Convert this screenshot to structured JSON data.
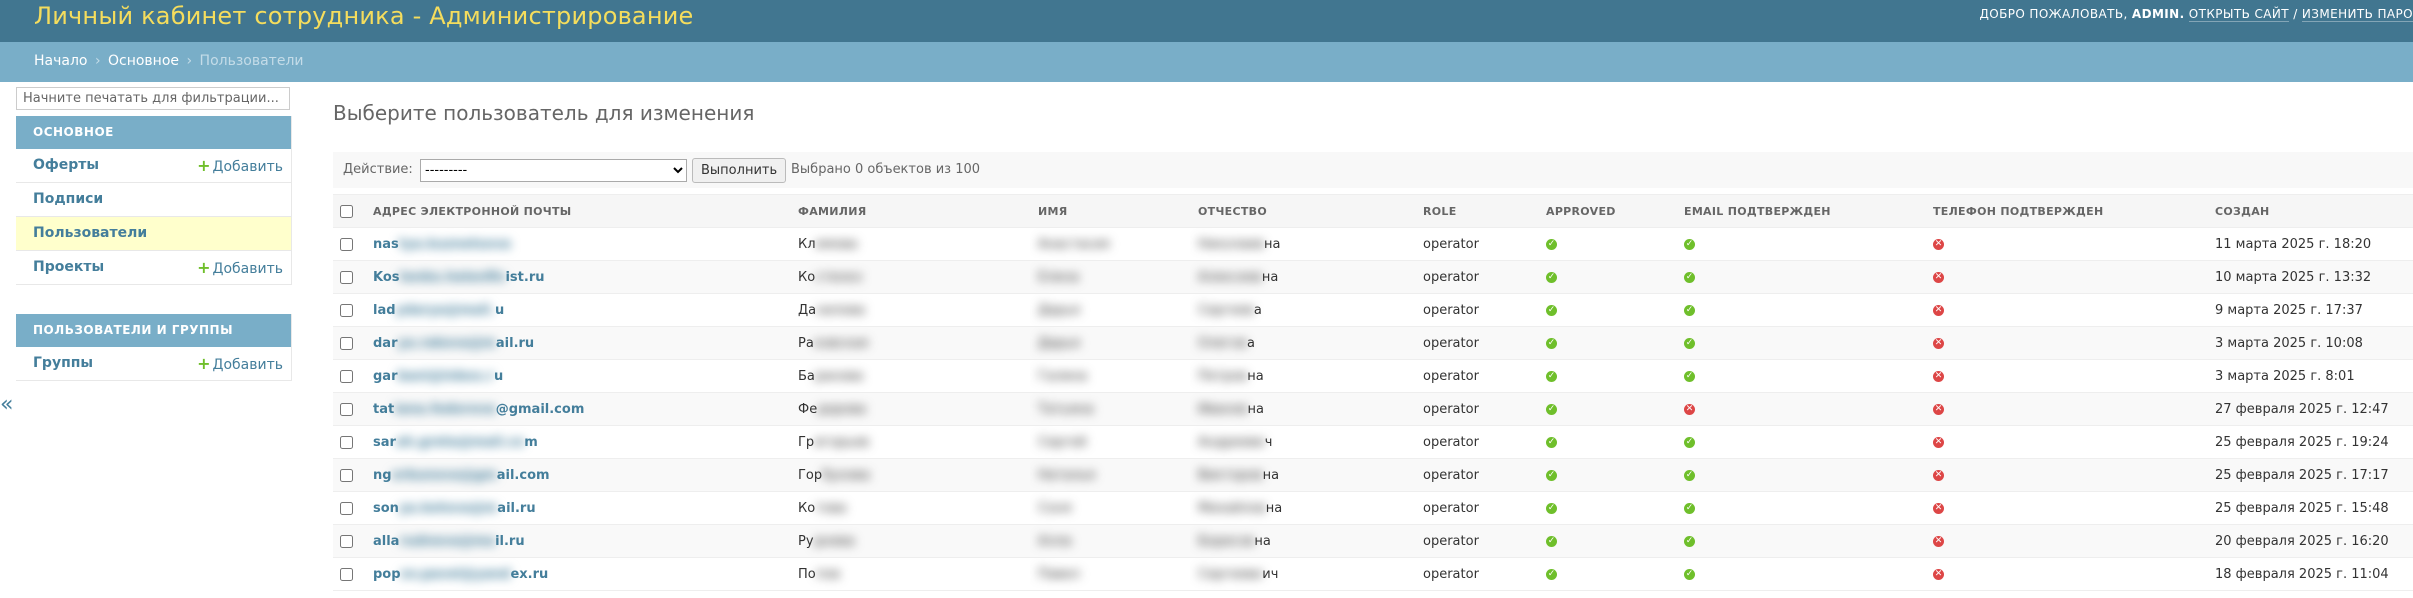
{
  "header": {
    "title": "Личный кабинет сотрудника - Администрирование",
    "welcome": "ДОБРО ПОЖАЛОВАТЬ,",
    "username": "ADMIN.",
    "view_site": "ОТКРЫТЬ САЙТ",
    "separator": "/",
    "change_password": "ИЗМЕНИТЬ ПАРО"
  },
  "breadcrumbs": {
    "home": "Начало",
    "app": "Основное",
    "current": "Пользователи",
    "sep": "›"
  },
  "sidebar": {
    "filter_placeholder": "Начните печатать для фильтрации...",
    "modules": [
      {
        "caption": "Основное",
        "models": [
          {
            "name": "Оферты",
            "add": "Добавить"
          },
          {
            "name": "Подписи",
            "add": ""
          },
          {
            "name": "Пользователи",
            "add": ""
          },
          {
            "name": "Проекты",
            "add": "Добавить"
          }
        ]
      },
      {
        "caption": "Пользователи и группы",
        "models": [
          {
            "name": "Группы",
            "add": "Добавить"
          }
        ]
      }
    ],
    "plus": "+",
    "toggle": "«"
  },
  "content": {
    "title": "Выберите пользователь для изменения",
    "action_label": "Действие:",
    "action_selected": "---------",
    "go_button": "Выполнить",
    "counter": "Выбрано 0 объектов из 100"
  },
  "table": {
    "columns": [
      "Адрес электронной почты",
      "Фамилия",
      "Имя",
      "Отчество",
      "Role",
      "Approved",
      "Email подтвержден",
      "Телефон подтвержден",
      "Создан"
    ],
    "rows": [
      {
        "email_start": "nas",
        "email_mask": "tya.kuznetsova",
        "email_end": "",
        "last_start": "Кл",
        "last_mask": "имова",
        "first": "Анастасия",
        "middle_mask": "Николаев",
        "middle_end": "на",
        "role": "operator",
        "approved": true,
        "email_confirmed": true,
        "phone_confirmed": false,
        "created": "11 марта 2025 г. 18:20"
      },
      {
        "email_start": "Kos",
        "email_mask": "tenko.helenfin",
        "email_end": "ist.ru",
        "last_start": "Ко",
        "last_mask": "стенко",
        "first": "Елена",
        "middle_mask": "Алексеев",
        "middle_end": "на",
        "role": "operator",
        "approved": true,
        "email_confirmed": true,
        "phone_confirmed": false,
        "created": "10 марта 2025 г. 13:32"
      },
      {
        "email_start": "lad",
        "email_mask": "ydarya@mail.",
        "email_end": "u",
        "last_start": "Да",
        "last_mask": "нилова",
        "first": "Дарья",
        "middle_mask": "Сергеев",
        "middle_end": "а",
        "role": "operator",
        "approved": true,
        "email_confirmed": true,
        "phone_confirmed": false,
        "created": "9 марта 2025 г. 17:37"
      },
      {
        "email_start": "dar",
        "email_mask": "ya.rakova@m",
        "email_end": "ail.ru",
        "last_start": "Ра",
        "last_mask": "ковская",
        "first": "Дарья",
        "middle_mask": "Олегов",
        "middle_end": "а",
        "role": "operator",
        "approved": true,
        "email_confirmed": true,
        "phone_confirmed": false,
        "created": "3 марта 2025 г. 10:08"
      },
      {
        "email_start": "gar",
        "email_mask": "bani@inbox.r",
        "email_end": "u",
        "last_start": "Ба",
        "last_mask": "ранова",
        "first": "Галина",
        "middle_mask": "Петров",
        "middle_end": "на",
        "role": "operator",
        "approved": true,
        "email_confirmed": true,
        "phone_confirmed": false,
        "created": "3 марта 2025 г. 8:01"
      },
      {
        "email_start": "tat",
        "email_mask": "iana.fedorova",
        "email_end": "@gmail.com",
        "last_start": "Фе",
        "last_mask": "дорова",
        "first": "Татьяна",
        "middle_mask": "Иванов",
        "middle_end": "на",
        "role": "operator",
        "approved": true,
        "email_confirmed": false,
        "phone_confirmed": false,
        "created": "27 февраля 2025 г. 12:47"
      },
      {
        "email_start": "sar",
        "email_mask": "ah.greta@mail.co",
        "email_end": "m",
        "last_start": "Гр",
        "last_mask": "игорьев",
        "first": "Сергей",
        "middle_mask": "Андрееви",
        "middle_end": "ч",
        "role": "operator",
        "approved": true,
        "email_confirmed": true,
        "phone_confirmed": false,
        "created": "25 февраля 2025 г. 19:24"
      },
      {
        "email_start": "ng",
        "email_mask": "orbunova@gm",
        "email_end": "ail.com",
        "last_start": "Гор",
        "last_mask": "бунова",
        "first": "Наталья",
        "middle_mask": "Викторов",
        "middle_end": "на",
        "role": "operator",
        "approved": true,
        "email_confirmed": true,
        "phone_confirmed": false,
        "created": "25 февраля 2025 г. 17:17"
      },
      {
        "email_start": "son",
        "email_mask": "ya.kotova@m",
        "email_end": "ail.ru",
        "last_start": "Ко",
        "last_mask": "това",
        "first": "Соня",
        "middle_mask": "Михайлов",
        "middle_end": "на",
        "role": "operator",
        "approved": true,
        "email_confirmed": true,
        "phone_confirmed": false,
        "created": "25 февраля 2025 г. 15:48"
      },
      {
        "email_start": "alla",
        "email_mask": "rudneva@ma",
        "email_end": "il.ru",
        "last_start": "Ру",
        "last_mask": "днева",
        "first": "Алла",
        "middle_mask": "Борисов",
        "middle_end": "на",
        "role": "operator",
        "approved": true,
        "email_confirmed": true,
        "phone_confirmed": false,
        "created": "20 февраля 2025 г. 16:20"
      },
      {
        "email_start": "pop",
        "email_mask": "ov.pavel@yand",
        "email_end": "ex.ru",
        "last_start": "По",
        "last_mask": "пов",
        "first": "Павел",
        "middle_mask": "Сергееви",
        "middle_end": "ич",
        "role": "operator",
        "approved": true,
        "email_confirmed": true,
        "phone_confirmed": false,
        "created": "18 февраля 2025 г. 11:04"
      }
    ]
  },
  "colors": {
    "header_bg": "#417690",
    "branding": "#f5dd5d",
    "breadcrumbs_bg": "#79aec8",
    "link": "#447e9b",
    "active_row": "#ffffcc",
    "bool_true": "#6fbf2b",
    "bool_false": "#dd4646"
  },
  "icons": {
    "bool_true": "✓",
    "bool_false": "✕"
  }
}
